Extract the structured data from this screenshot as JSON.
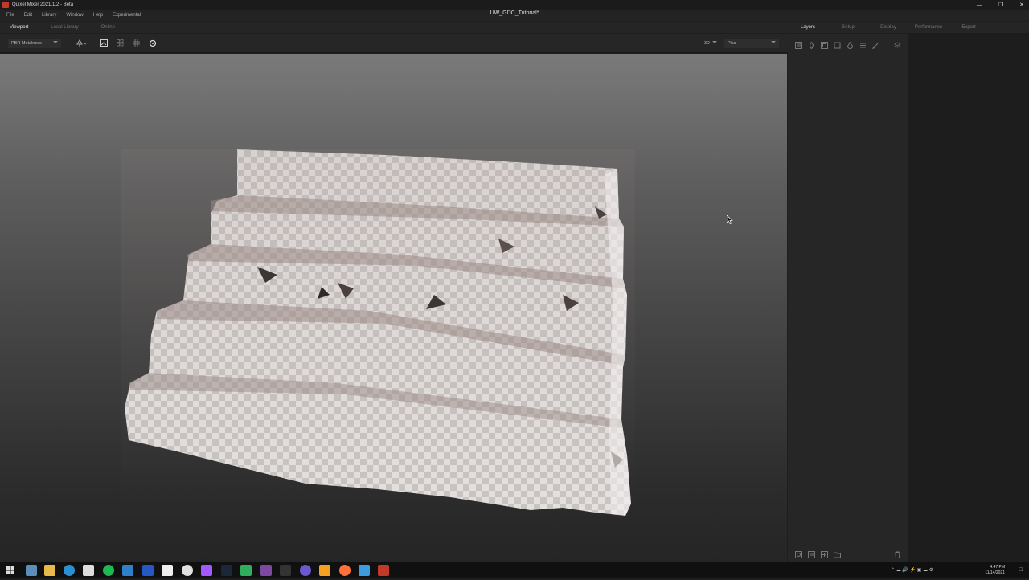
{
  "window": {
    "app_title": "Quixel Mixer 2021.1.2 - Beta",
    "doc_title": "UW_GDC_Tutorial*"
  },
  "menu": [
    "File",
    "Edit",
    "Library",
    "Window",
    "Help",
    "Experimental"
  ],
  "tabs": [
    {
      "label": "Viewport",
      "active": true
    },
    {
      "label": "Local Library",
      "active": false
    },
    {
      "label": "Online",
      "active": false
    }
  ],
  "toolbar": {
    "shading_mode": "PBR Metalness",
    "view_mode": "3D",
    "environment": "Pisa"
  },
  "right_tabs": [
    {
      "label": "Layers",
      "active": true
    },
    {
      "label": "Setup",
      "active": false
    },
    {
      "label": "Display",
      "active": false
    },
    {
      "label": "Performance",
      "active": false
    },
    {
      "label": "Export",
      "active": false
    }
  ],
  "tray": {
    "time": "4:47 PM",
    "date": "11/14/2021"
  },
  "colors": {
    "accent": "#c0392b",
    "panel": "#262626",
    "viewport_top": "#7a7a7a",
    "viewport_bottom": "#252525"
  }
}
